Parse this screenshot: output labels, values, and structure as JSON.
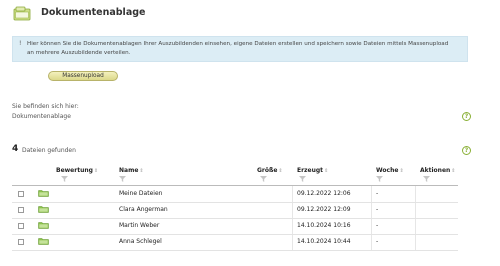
{
  "page": {
    "title": "Dokumentenablage"
  },
  "info": {
    "icon": "info-icon",
    "text": "Hier können Sie die Dokumentenablagen Ihrer Auszubildenden einsehen, eigene Dateien erstellen und speichern sowie Dateien mittels Massenupload an mehrere Auszubildende verteilen."
  },
  "toolbar": {
    "mass_upload_label": "Massenupload"
  },
  "breadcrumb": {
    "label": "Sie befinden sich hier:",
    "path": "Dokumentenablage"
  },
  "results": {
    "count": "4",
    "label": "Dateien gefunden"
  },
  "table": {
    "columns": [
      "Bewertung",
      "Name",
      "Größe",
      "Erzeugt",
      "Woche",
      "Aktionen"
    ],
    "rows": [
      {
        "name": "Meine Dateien",
        "created": "09.12.2022 12:06",
        "week": "-"
      },
      {
        "name": "Clara Angerman",
        "created": "09.12.2022 12:09",
        "week": "-"
      },
      {
        "name": "Martin Weber",
        "created": "14.10.2024 10:16",
        "week": "-"
      },
      {
        "name": "Anna Schlegel",
        "created": "14.10.2024 10:44",
        "week": "-"
      }
    ]
  },
  "colors": {
    "info_bg": "#dcedf5",
    "button_bg": "#e6e3a3",
    "help_icon": "#8ab036",
    "folder_icon": "#8bc34a"
  }
}
